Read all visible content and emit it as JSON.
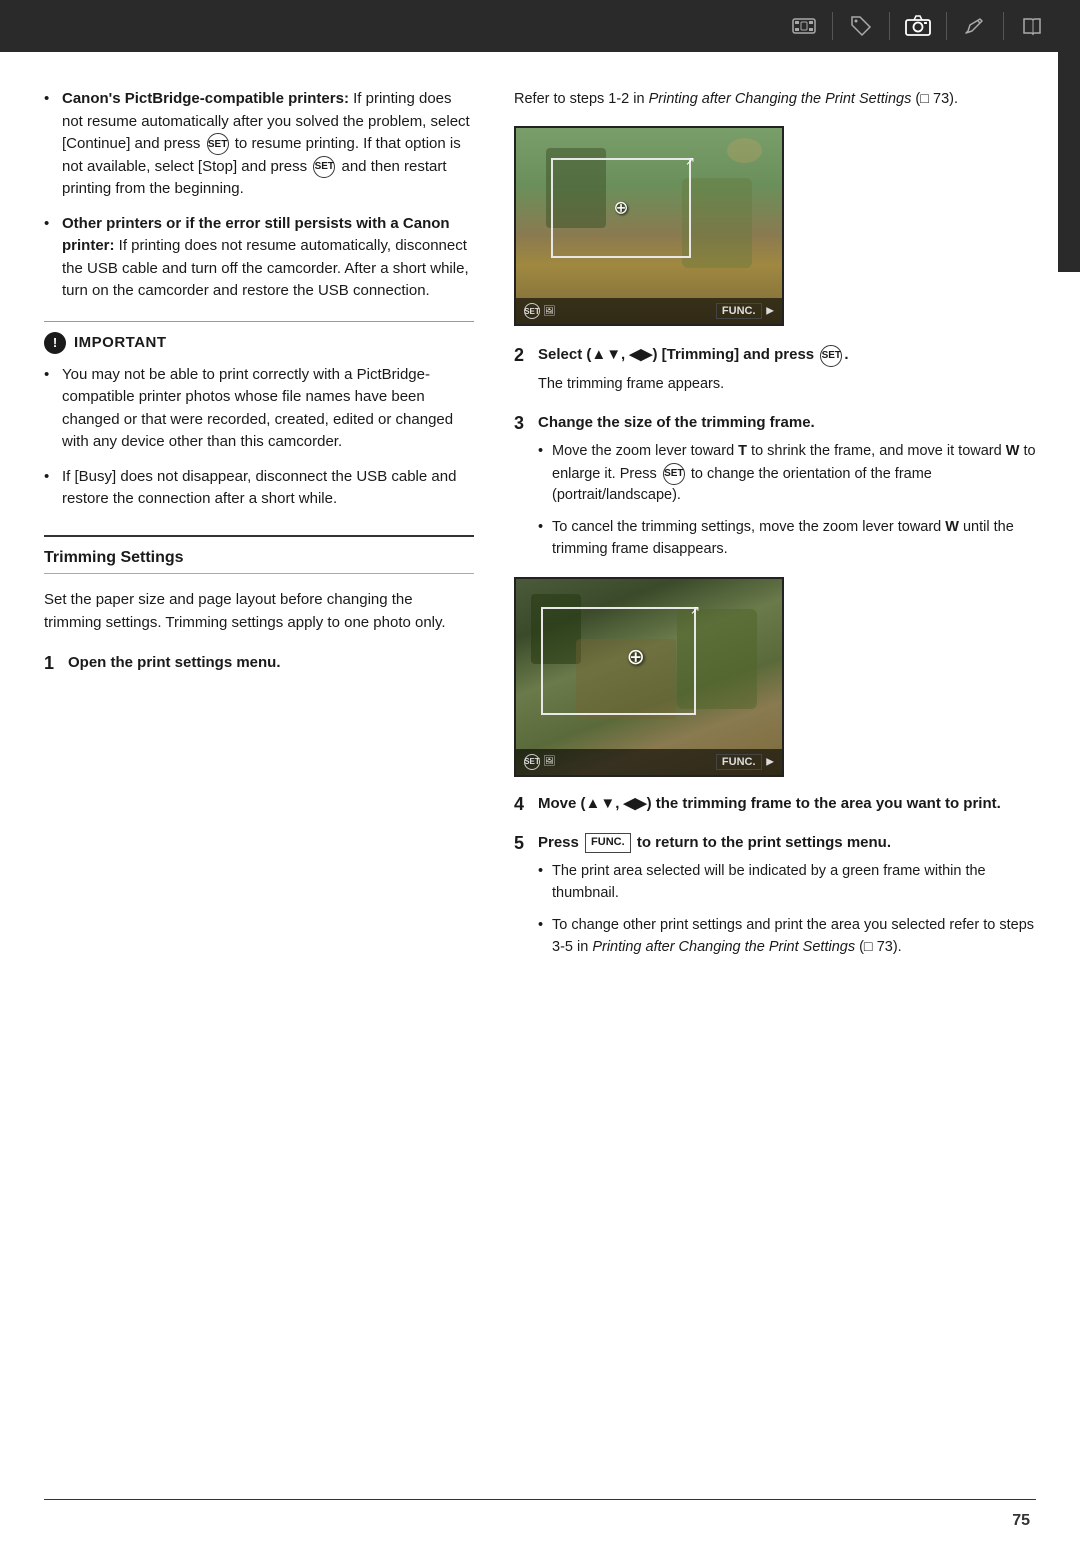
{
  "topbar": {
    "icons": [
      "camera-film-icon",
      "tag-icon",
      "camera-icon",
      "pencil-icon",
      "book-icon"
    ]
  },
  "left_col": {
    "bullets": [
      {
        "id": "bullet-pictbridge",
        "bold_prefix": "Canon's PictBridge-compatible printers:",
        "text": " If printing does not resume automatically after you solved the problem, select [Continue] and press SET to resume printing. If that option is not available, select [Stop] and press SET and then restart printing from the beginning."
      },
      {
        "id": "bullet-other-printers",
        "bold_prefix": "Other printers or if the error still persists with a Canon printer:",
        "text": " If printing does not resume automatically, disconnect the USB cable and turn off the camcorder. After a short while, turn on the camcorder and restore the USB connection."
      }
    ],
    "important": {
      "title": "IMPORTANT",
      "bullets": [
        "You may not be able to print correctly with a PictBridge-compatible printer photos whose file names have been changed or that were recorded, created, edited or changed with any device other than this camcorder.",
        "If [Busy] does not disappear, disconnect the USB cable and restore the connection after a short while."
      ]
    },
    "trimming": {
      "title": "Trimming Settings",
      "intro": "Set the paper size and page layout before changing the trimming settings. Trimming settings apply to one photo only.",
      "step1_num": "1",
      "step1_text": "Open the print settings menu."
    }
  },
  "right_col": {
    "ref_text": "Refer to steps 1-2 in Printing after Changing the Print Settings (",
    "ref_page": "m 73).",
    "step2_num": "2",
    "step2_title": "Select (▲▼, ◀▶) [Trimming] and press SET.",
    "step2_sub": "The trimming frame appears.",
    "step3_num": "3",
    "step3_title": "Change the size of the trimming frame.",
    "step3_bullets": [
      "Move the zoom lever toward T to shrink the frame, and move it toward W to enlarge it. Press SET to change the orientation of the frame (portrait/landscape).",
      "To cancel the trimming settings, move the zoom lever toward W until the trimming frame disappears."
    ],
    "step4_num": "4",
    "step4_title": "Move (▲▼, ◀▶) the trimming frame to the area you want to print.",
    "step5_num": "5",
    "step5_title": "Press FUNC. to return to the print settings menu.",
    "step5_bullets": [
      "The print area selected will be indicated by a green frame within the thumbnail.",
      "To change other print settings and print the area you selected refer to steps 3-5 in Printing after Changing the Print Settings (m 73)."
    ],
    "cam_set_label": "SET",
    "cam_func_label": "FUNC.",
    "cam_portrait_icon": "🖼",
    "move_trimming_text": "Move the trimming"
  },
  "footer": {
    "page_num": "75"
  }
}
